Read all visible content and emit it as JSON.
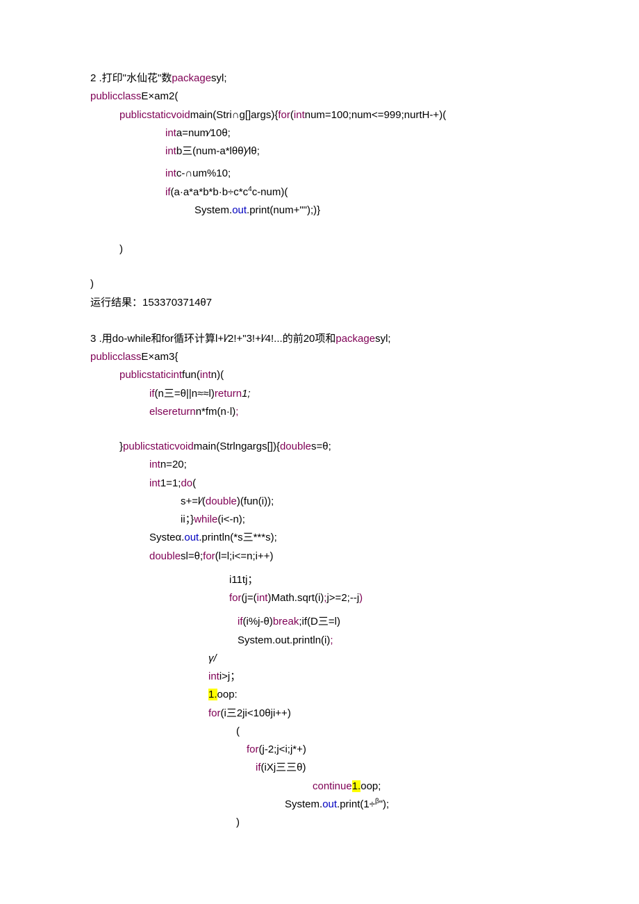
{
  "p2_title_a": "2 .打印\"水仙花\"数",
  "p2_pkg": "package",
  "p2_syl": "syl;",
  "p2_l1a": "publicclass",
  "p2_l1b": "E×am2(",
  "p2_l2a": "publicstaticvoid",
  "p2_l2b": "main(Stri∩g[]args){",
  "p2_l2c": "for",
  "p2_l2d": "(",
  "p2_l2e": "int",
  "p2_l2f": "num=100;num<=999;nurtH-+)(",
  "p2_l3a": "int",
  "p2_l3b": "a=num∕10θ;",
  "p2_l4a": "int",
  "p2_l4b": "b三(num-a*lθθ)∕lθ;",
  "p2_l5a": "int",
  "p2_l5b": "c-∩um%10;",
  "p2_l6a": "if",
  "p2_l6b": "(a·a*a*b*b·b÷c*c",
  "p2_l6c": "4",
  "p2_l6d": "c-num)(",
  "p2_l7a": "System.",
  "p2_l7b": "out",
  "p2_l7c": ".print(num+\"\");)}",
  "p2_l8": ")",
  "p2_l9": ")",
  "p2_result": "运行结果：1533703714θ7",
  "p3_title_a": "3 .用do-while和for循环计算l+l∕2!+\"3!+l∕4!...的前20项和",
  "p3_pkg": "package",
  "p3_syl": "syl;",
  "p3_l1a": "publicclass",
  "p3_l1b": "E×am3{",
  "p3_l2a": "publicstaticint",
  "p3_l2b": "fun(",
  "p3_l2c": "int",
  "p3_l2d": "n)(",
  "p3_l3a": "if",
  "p3_l3b": "(n三=θ||n≈≈l)",
  "p3_l3c": "return",
  "p3_l3d": "1;",
  "p3_l4a": "elsereturn",
  "p3_l4b": "n*fm(n·l)",
  "p3_l4c": ";",
  "p3_l5a": "}",
  "p3_l5b": "publicstaticvoid",
  "p3_l5c": "main(Strlngargs[]){",
  "p3_l5d": "double",
  "p3_l5e": "s=θ;",
  "p3_l6a": "int",
  "p3_l6b": "n=20;",
  "p3_l7a": "int",
  "p3_l7b": "1=1;",
  "p3_l7c": "do",
  "p3_l7d": "(",
  "p3_l8": "s+=l∕(",
  "p3_l8b": "double",
  "p3_l8c": ")(fun(i));",
  "p3_l9a": "ii；}",
  "p3_l9b": "while",
  "p3_l9c": "(i<-n);",
  "p3_l10a": "Systeα.",
  "p3_l10b": "out",
  "p3_l10c": ".println(*s三***s);",
  "p3_l11a": "double",
  "p3_l11b": "sl=θ;",
  "p3_l11c": "for",
  "p3_l11d": "(l=l;i<=n;i++)",
  "p3_l12": "i11tj；",
  "p3_l13a": "for",
  "p3_l13b": "(j=(",
  "p3_l13c": "int",
  "p3_l13d": ")Math.sqrt(i)",
  "p3_l13e": ";",
  "p3_l13f": "j>=2;--j",
  "p3_l13g": ")",
  "p3_l14a": "if",
  "p3_l14b": "(i%j-θ)",
  "p3_l14c": "break",
  "p3_l14d": ";if",
  "p3_l14e": "(D三=l)",
  "p3_l15": "System.out.println(i)",
  "p3_l15b": ";",
  "p3_l16": "γ/",
  "p3_l17a": "int",
  "p3_l17b": "i>j；",
  "p3_l18a": "1.",
  "p3_l18b": "oop:",
  "p3_l19a": "for",
  "p3_l19b": "(i三2ji<10θji++)",
  "p3_l20": "(",
  "p3_l21a": "for",
  "p3_l21b": "(j-2;j<i;j*+)",
  "p3_l22a": "if",
  "p3_l22b": "(iXj三三θ)",
  "p3_l23a": "continue",
  "p3_l23b": "1.",
  "p3_l23c": "oop;",
  "p3_l24a": "System.",
  "p3_l24b": "out",
  "p3_l24c": ".print(1÷",
  "p3_l24d": "β",
  "p3_l24e": "\");",
  "p3_l25": ")"
}
